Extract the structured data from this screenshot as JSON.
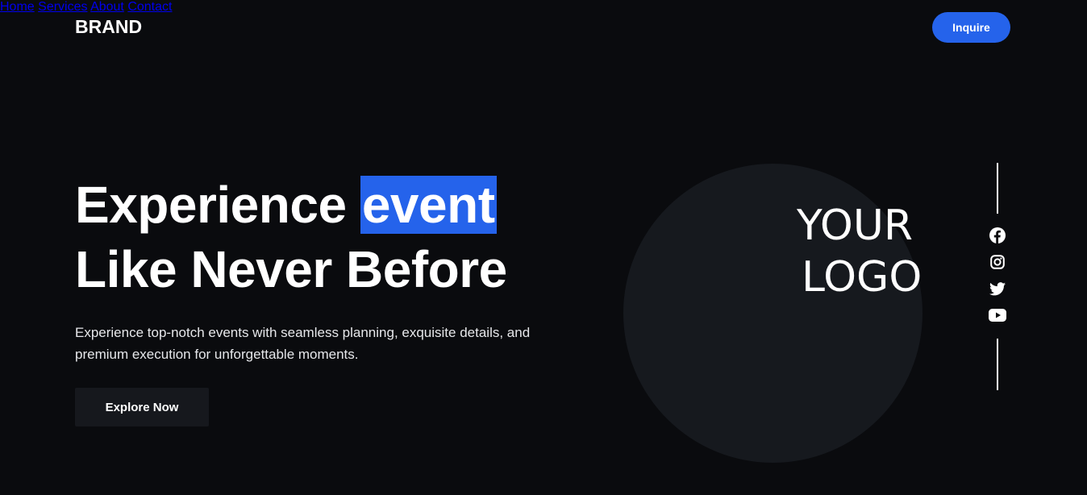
{
  "header": {
    "brand": "BRAND",
    "nav": [
      "Home",
      "Services",
      "About",
      "Contact"
    ],
    "cta_label": "Inquire"
  },
  "hero": {
    "headline_pre": "Experience ",
    "headline_highlight": "event",
    "headline_line2": "Like Never Before",
    "subtitle": "Experience top-notch events with seamless planning, exquisite details, and premium execution for unforgettable moments.",
    "button_label": "Explore Now"
  },
  "logo_placeholder": {
    "line1": "YOUR",
    "line2": "LOGO"
  },
  "social": [
    "facebook-icon",
    "instagram-icon",
    "twitter-icon",
    "youtube-icon"
  ],
  "colors": {
    "background": "#0a0b0e",
    "accent": "#2563eb",
    "circle": "#16191e",
    "button_dark": "#16181d"
  }
}
